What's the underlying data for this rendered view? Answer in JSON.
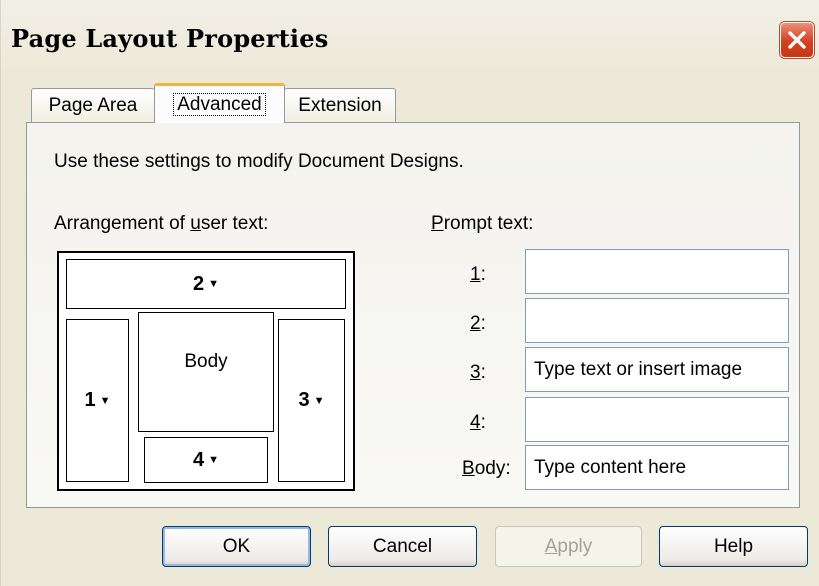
{
  "window": {
    "title": "Page Layout Properties",
    "close_icon": "close-icon"
  },
  "tabs": [
    {
      "label": "Page Area",
      "active": false
    },
    {
      "label": "Advanced",
      "active": true
    },
    {
      "label": "Extension",
      "active": false
    }
  ],
  "panel": {
    "description": "Use these settings to modify Document Designs.",
    "arrangement_label_pre": "Arrangement of ",
    "arrangement_label_key": "u",
    "arrangement_label_post": "ser text:",
    "arrangement": {
      "top": "2",
      "left": "1",
      "center": "Body",
      "right": "3",
      "bottom": "4",
      "caret_icon": "dropdown-caret-icon"
    },
    "prompt_label_key": "P",
    "prompt_label_post": "rompt text:",
    "prompts": [
      {
        "key": "1",
        "suffix": ":",
        "value": ""
      },
      {
        "key": "2",
        "suffix": ":",
        "value": ""
      },
      {
        "key": "3",
        "suffix": ":",
        "value": "Type text or insert image"
      },
      {
        "key": "4",
        "suffix": ":",
        "value": ""
      },
      {
        "key": "B",
        "suffix": "ody:",
        "value": "Type content here"
      }
    ]
  },
  "buttons": {
    "ok": "OK",
    "cancel": "Cancel",
    "apply_key": "A",
    "apply_rest": "pply",
    "help": "Help"
  },
  "colors": {
    "dialog_bg": "#ece9d8",
    "close_red": "#d5401f",
    "active_tab_accent": "#f2b33a"
  }
}
